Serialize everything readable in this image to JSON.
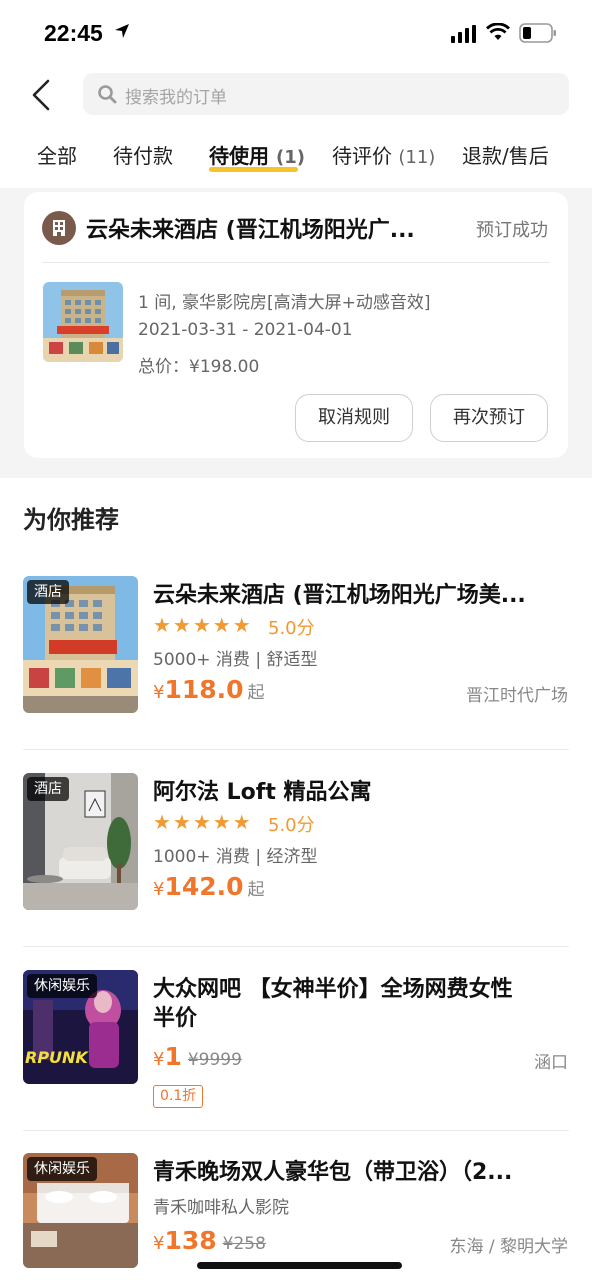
{
  "status_bar": {
    "time": "22:45"
  },
  "search": {
    "placeholder": "搜索我的订单"
  },
  "tabs": [
    {
      "label": "全部",
      "count": ""
    },
    {
      "label": "待付款",
      "count": ""
    },
    {
      "label": "待使用",
      "count": "(1)"
    },
    {
      "label": "待评价",
      "count": "(11)"
    },
    {
      "label": "退款/售后",
      "count": ""
    }
  ],
  "active_tab": "待使用",
  "order": {
    "name": "云朵未来酒店 (晋江机场阳光广...",
    "status": "预订成功",
    "room": "1 间, 豪华影院房[高清大屏+动感音效]",
    "dates": "2021-03-31 - 2021-04-01",
    "total": "总价：¥198.00",
    "cancel_rule_label": "取消规则",
    "rebook_label": "再次预订"
  },
  "recommend": {
    "title": "为你推荐",
    "items": [
      {
        "tag": "酒店",
        "name": "云朵未来酒店 (晋江机场阳光广场美...",
        "stars": "★★★★★",
        "score": "5.0分",
        "sub": "5000+ 消费 | 舒适型",
        "price_symbol": "¥",
        "price": "118.0",
        "price_suffix": "起",
        "location": "晋江时代广场"
      },
      {
        "tag": "酒店",
        "name": "阿尔法 Loft 精品公寓",
        "stars": "★★★★★",
        "score": "5.0分",
        "sub": "1000+ 消费 | 经济型",
        "price_symbol": "¥",
        "price": "142.0",
        "price_suffix": "起",
        "location": ""
      },
      {
        "tag": "休闲娱乐",
        "name_line1": "大众网吧 【女神半价】全场网费女性",
        "name_line2": "半价",
        "price_symbol": "¥",
        "price": "1",
        "old_price": "¥9999",
        "location": "涵口",
        "discount": "0.1折"
      },
      {
        "tag": "休闲娱乐",
        "name": "青禾晚场双人豪华包（带卫浴）（2...",
        "sub": "青禾咖啡私人影院",
        "price_symbol": "¥",
        "price": "138",
        "old_price": "¥258",
        "location": "东海 / 黎明大学"
      }
    ]
  },
  "colors": {
    "accent_orange": "#f0762b",
    "star_orange": "#f19a33",
    "tab_underline": "#f6c32b",
    "hotel_badge": "#7a5b4b"
  }
}
